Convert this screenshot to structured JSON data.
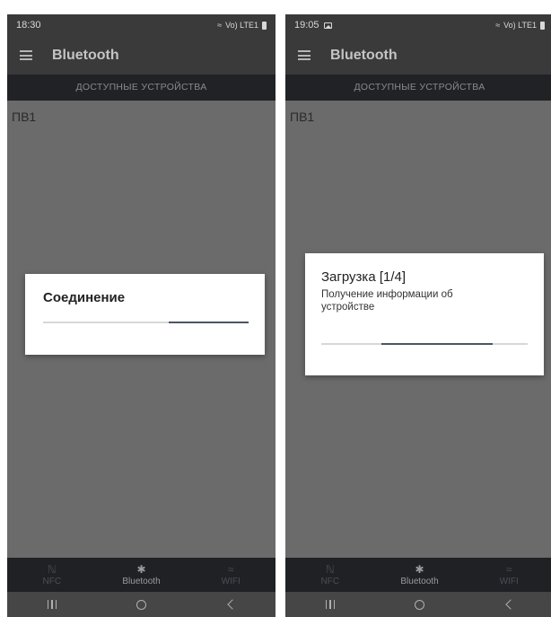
{
  "left_screen": {
    "status_time": "18:30",
    "status_network": "Vo) LTE1",
    "app_title": "Bluetooth",
    "tab_label": "ДОСТУПНЫЕ УСТРОЙСТВА",
    "devices": [
      "ПВ1"
    ],
    "dialog": {
      "title": "Соединение",
      "progress_start": 0.61,
      "progress_end": 1.0
    },
    "bottom_nav": {
      "nfc": {
        "label": "NFC",
        "icon": "nfc-icon"
      },
      "bluetooth": {
        "label": "Bluetooth",
        "icon": "bluetooth-icon"
      },
      "wifi": {
        "label": "WIFI",
        "icon": "wifi-icon"
      }
    }
  },
  "right_screen": {
    "status_time": "19:05",
    "status_network": "Vo) LTE1",
    "app_title": "Bluetooth",
    "tab_label": "ДОСТУПНЫЕ УСТРОЙСТВА",
    "devices": [
      "ПВ1"
    ],
    "dialog": {
      "title": "Загрузка [1/4]",
      "message": "Получение информации об устройстве",
      "progress_start": 0.29,
      "progress_end": 0.83
    },
    "bottom_nav": {
      "nfc": {
        "label": "NFC",
        "icon": "nfc-icon"
      },
      "bluetooth": {
        "label": "Bluetooth",
        "icon": "bluetooth-icon"
      },
      "wifi": {
        "label": "WIFI",
        "icon": "wifi-icon"
      }
    }
  },
  "colors": {
    "app_bar": "#3a3a3a",
    "tab_strip": "#202226",
    "content_dim": "#6b6b6b",
    "progress_fill": "#4d5560",
    "progress_track": "#d7d7d7"
  }
}
